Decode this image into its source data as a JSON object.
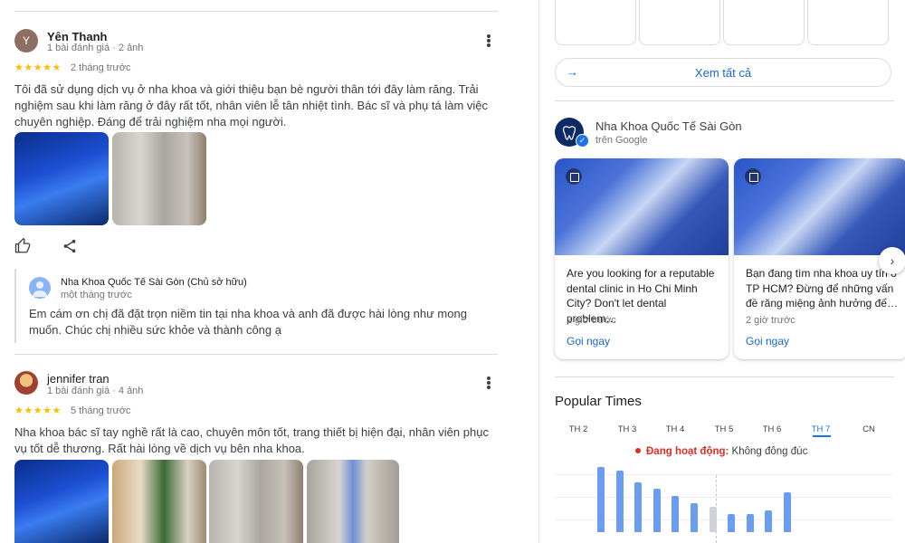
{
  "reviews": [
    {
      "initial": "Y",
      "name": "Yên Thanh",
      "meta": "1 bài đánh giá · 2 ảnh",
      "stars": "★★★★★",
      "when": "2 tháng trước",
      "text": "Tôi đã sử dụng dịch vụ ở nha khoa và giới thiệu bạn bè người thân tới đây làm răng. Trải nghiệm sau khi làm răng ở đây rất tốt, nhân viên lễ tân nhiệt tình. Bác sĩ và phụ tá làm việc chuyên nghiệp. Đáng để trải nghiệm nha mọi người.",
      "owner_reply": {
        "name": "Nha Khoa Quốc Tế Sài Gòn (Chủ sở hữu)",
        "when": "một tháng trước",
        "text": "Em cám ơn chị đã đặt trọn niềm tin tại nha khoa và anh đã được hài lòng như mong muốn. Chúc chị nhiều sức khỏe và thành công ạ"
      }
    },
    {
      "name": "jennifer tran",
      "meta": "1 bài đánh giá · 4 ảnh",
      "stars": "★★★★★",
      "when": "5 tháng trước",
      "text": "Nha khoa bác sĩ tay nghề rất là cao, chuyên môn tốt, trang thiết bị hiện đại, nhân viên phục vụ tốt dễ thương. Rất hài lòng về dịch vụ bên nha khoa."
    }
  ],
  "sidebar": {
    "see_all": "Xem tất cả",
    "business": {
      "name": "Nha Khoa Quốc Tế Sài Gòn",
      "source": "trên Google"
    },
    "posts": [
      {
        "text": "Are you looking for a reputable dental clinic in Ho Chi Minh City? Don't let dental problem…",
        "time": "2 giờ trước",
        "cta": "Gọi ngay"
      },
      {
        "text": "Bạn đang tìm nha khoa uy tín ở TP HCM? Đừng để những vấn đề răng miệng ảnh hưởng đế…",
        "time": "2 giờ trước",
        "cta": "Gọi ngay"
      }
    ],
    "popular_times": {
      "title": "Popular Times",
      "days": [
        "TH 2",
        "TH 3",
        "TH 4",
        "TH 5",
        "TH 6",
        "TH 7",
        "CN"
      ],
      "selected_day": "TH 7",
      "live_label": "Đang hoạt động:",
      "live_value": "Không đông đúc",
      "bars": [
        85,
        80,
        65,
        57,
        47,
        38,
        33,
        23,
        23,
        28,
        52
      ],
      "current_bar_index": 6
    }
  },
  "colors": {
    "star": "#fbbc04",
    "link": "#1967d2",
    "accent": "#1a73e8",
    "live": "#d93025",
    "bar": "#6a9cf0"
  }
}
